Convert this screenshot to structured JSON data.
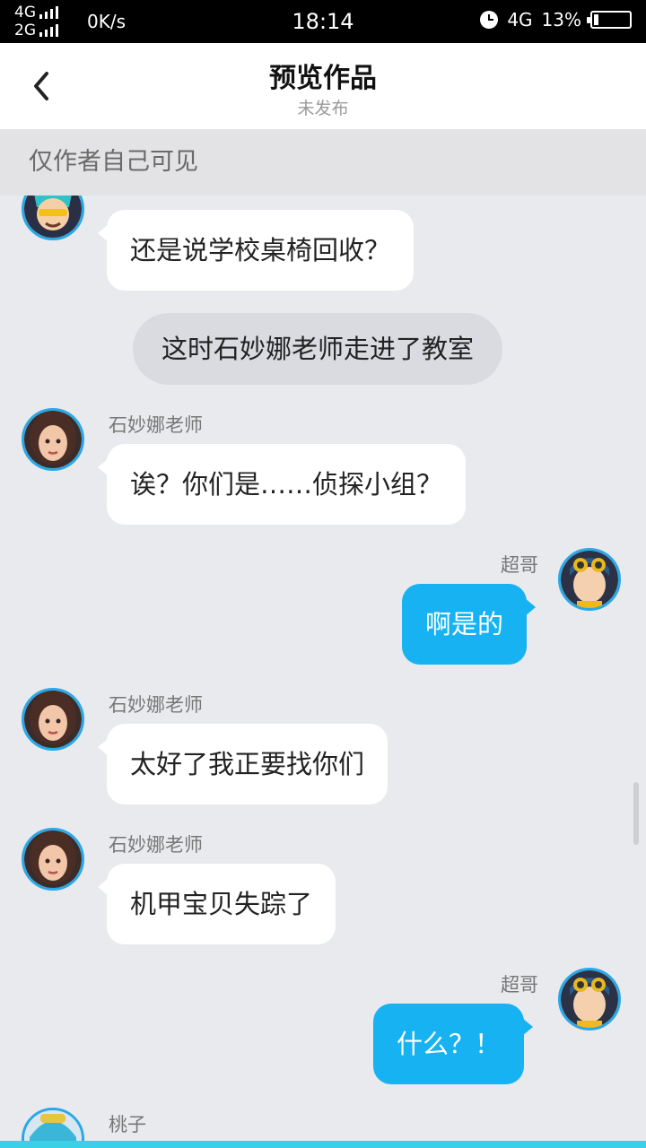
{
  "status_bar": {
    "net1": "4G",
    "net2": "2G",
    "speed": "0K/s",
    "time": "18:14",
    "net_right": "4G",
    "battery_text": "13%",
    "battery_level": 0.13
  },
  "header": {
    "title": "预览作品",
    "subtitle": "未发布"
  },
  "notice": "仅作者自己可见",
  "messages": [
    {
      "type": "left",
      "name": "",
      "text": "还是说学校桌椅回收？",
      "avatar": "yellow-glasses-boy-icon"
    },
    {
      "type": "narration",
      "text": "这时石妙娜老师走进了教室"
    },
    {
      "type": "left",
      "name": "石妙娜老师",
      "text": "诶？你们是……侦探小组？",
      "avatar": "teacher-girl-icon"
    },
    {
      "type": "right",
      "name": "超哥",
      "text": "啊是的",
      "avatar": "goggles-boy-icon"
    },
    {
      "type": "left",
      "name": "石妙娜老师",
      "text": "太好了我正要找你们",
      "avatar": "teacher-girl-icon"
    },
    {
      "type": "left",
      "name": "石妙娜老师",
      "text": "机甲宝贝失踪了",
      "avatar": "teacher-girl-icon"
    },
    {
      "type": "right",
      "name": "超哥",
      "text": "什么？！",
      "avatar": "goggles-boy-icon"
    },
    {
      "type": "left",
      "name": "桃子",
      "text": "",
      "avatar": "blue-hair-girl-icon"
    }
  ],
  "colors": {
    "accent": "#16b2f2",
    "avatar_border": "#29a8e8",
    "background": "#e9eaee"
  }
}
